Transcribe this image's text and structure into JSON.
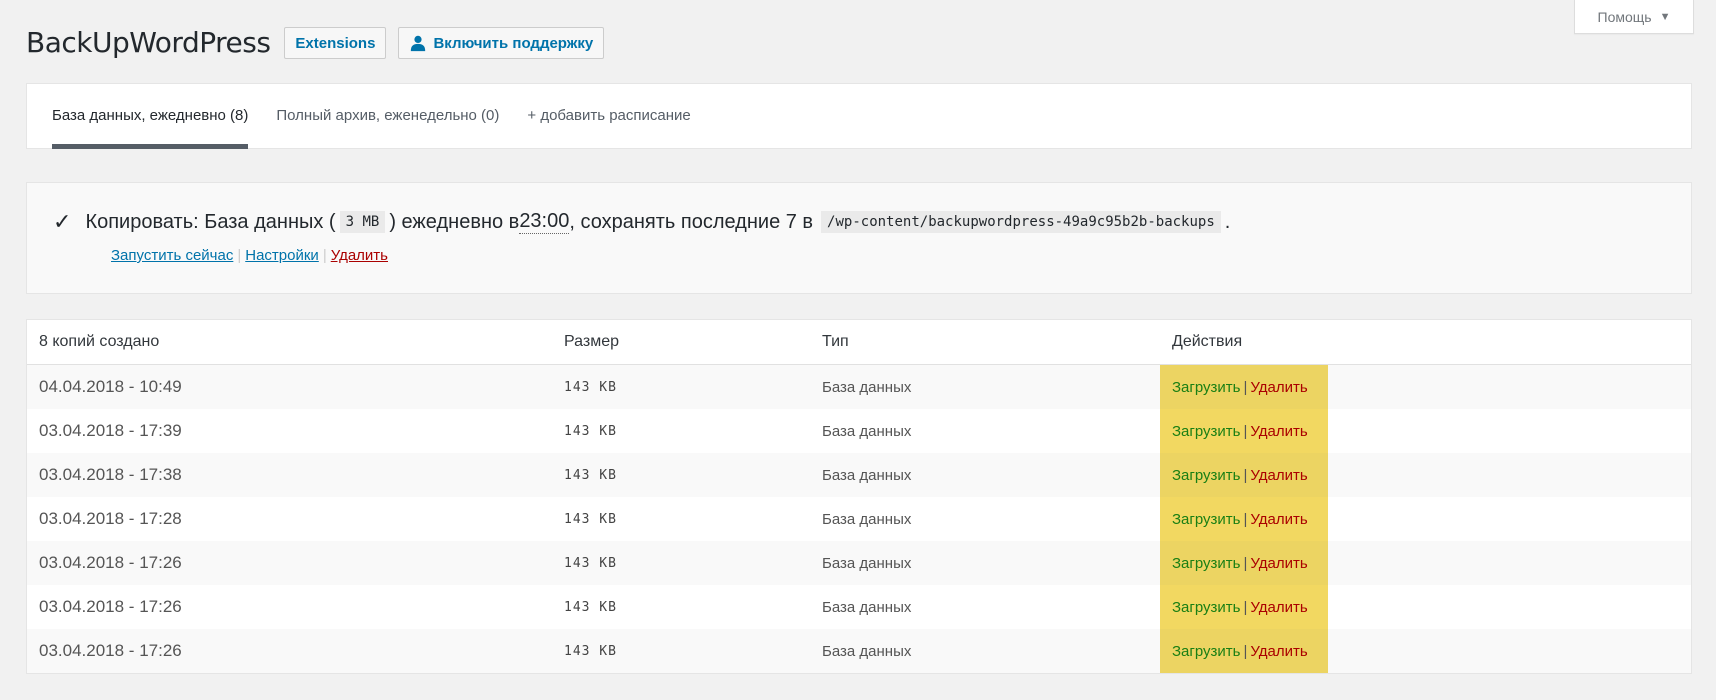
{
  "help": {
    "label": "Помощь"
  },
  "header": {
    "title": "BackUpWordPress",
    "extensions_label": "Extensions",
    "support_label": "Включить поддержку"
  },
  "tabs": [
    {
      "label": "База данных, ежедневно (8)",
      "active": true
    },
    {
      "label": "Полный архив, еженедельно (0)",
      "active": false
    },
    {
      "label": "+ добавить расписание",
      "active": false
    }
  ],
  "schedule": {
    "prefix": "Копировать: База данных (",
    "size": "3 MB",
    "middle1": ") ежедневно в ",
    "time": "23:00",
    "middle2": ", сохранять последние 7 в",
    "path": "/wp-content/backupwordpress-49a9c95b2b-backups",
    "suffix": ".",
    "links": {
      "run_now": "Запустить сейчас",
      "settings": "Настройки",
      "delete": "Удалить"
    }
  },
  "table": {
    "headers": {
      "created": "8 копий создано",
      "size": "Размер",
      "type": "Тип",
      "actions": "Действия"
    },
    "action_labels": {
      "download": "Загрузить",
      "separator": "|",
      "delete": "Удалить"
    },
    "rows": [
      {
        "date": "04.04.2018 - 10:49",
        "size": "143 KB",
        "type": "База данных"
      },
      {
        "date": "03.04.2018 - 17:39",
        "size": "143 KB",
        "type": "База данных"
      },
      {
        "date": "03.04.2018 - 17:38",
        "size": "143 KB",
        "type": "База данных"
      },
      {
        "date": "03.04.2018 - 17:28",
        "size": "143 KB",
        "type": "База данных"
      },
      {
        "date": "03.04.2018 - 17:26",
        "size": "143 KB",
        "type": "База данных"
      },
      {
        "date": "03.04.2018 - 17:26",
        "size": "143 KB",
        "type": "База данных"
      },
      {
        "date": "03.04.2018 - 17:26",
        "size": "143 KB",
        "type": "База данных"
      }
    ]
  },
  "colors": {
    "link": "#0073aa",
    "danger": "#aa0000",
    "download": "#1a7f14",
    "highlight": "#f2d861"
  }
}
